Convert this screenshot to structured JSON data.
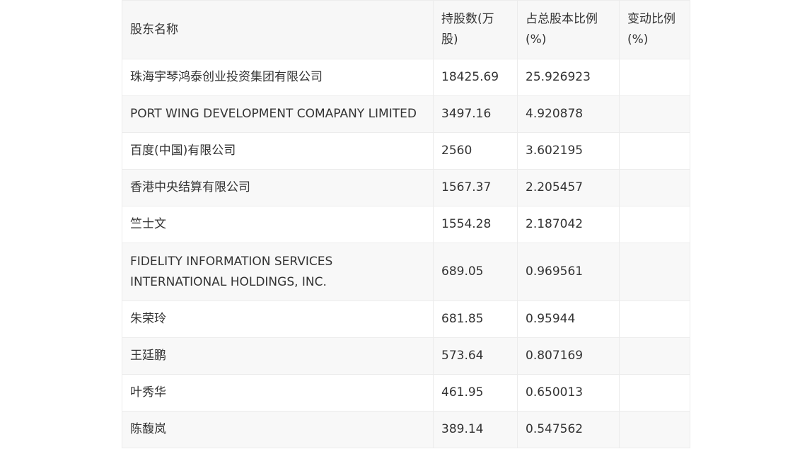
{
  "table": {
    "headers": [
      "股东名称",
      "持股数(万股)",
      "占总股本比例(%)",
      "变动比例(%)"
    ],
    "rows": [
      [
        "珠海宇琴鸿泰创业投资集团有限公司",
        "18425.69",
        "25.926923",
        ""
      ],
      [
        "PORT WING DEVELOPMENT COMAPANY LIMITED",
        "3497.16",
        "4.920878",
        ""
      ],
      [
        "百度(中国)有限公司",
        "2560",
        "3.602195",
        ""
      ],
      [
        "香港中央结算有限公司",
        "1567.37",
        "2.205457",
        ""
      ],
      [
        "竺士文",
        "1554.28",
        "2.187042",
        ""
      ],
      [
        "FIDELITY INFORMATION SERVICES INTERNATIONAL HOLDINGS, INC.",
        "689.05",
        "0.969561",
        ""
      ],
      [
        "朱荣玲",
        "681.85",
        "0.95944",
        ""
      ],
      [
        "王廷鹏",
        "573.64",
        "0.807169",
        ""
      ],
      [
        "叶秀华",
        "461.95",
        "0.650013",
        ""
      ],
      [
        "陈馥岚",
        "389.14",
        "0.547562",
        ""
      ]
    ]
  }
}
